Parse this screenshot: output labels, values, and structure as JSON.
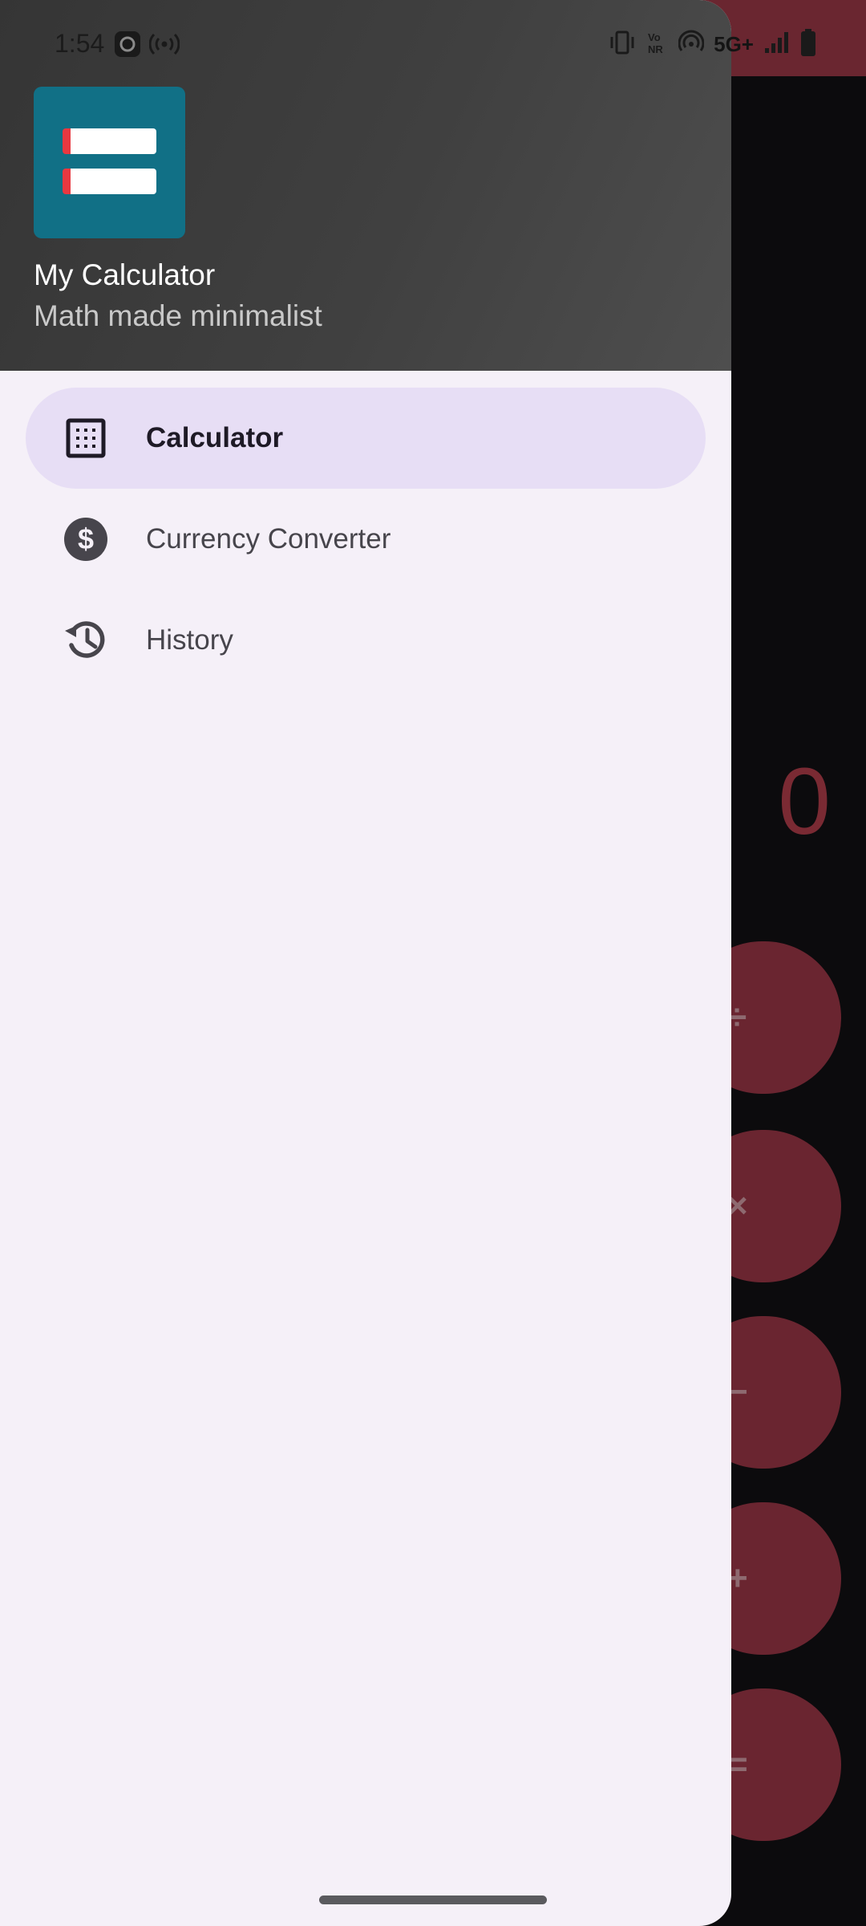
{
  "status_bar": {
    "time": "1:54",
    "network": "5G+",
    "left_icons": [
      "media-icon",
      "hotspot-icon"
    ],
    "right_icons": [
      "vibrate-icon",
      "vonr-icon",
      "wifi-calling-icon",
      "signal-icon",
      "battery-icon"
    ]
  },
  "drawer": {
    "app_name": "My Calculator",
    "tagline": "Math made minimalist",
    "items": [
      {
        "label": "Calculator",
        "icon": "calculator-icon",
        "selected": true
      },
      {
        "label": "Currency Converter",
        "icon": "dollar-icon",
        "selected": false
      },
      {
        "label": "History",
        "icon": "history-icon",
        "selected": false
      }
    ]
  },
  "background_app": {
    "display_value": "0",
    "operators": [
      "÷",
      "×",
      "−",
      "+",
      "="
    ]
  },
  "colors": {
    "drawer_bg": "#f5f0f8",
    "selected_item_bg": "#e7def5",
    "header_bg": "#3c3c3c",
    "logo_bg": "#117086",
    "accent_red": "#6a2530"
  }
}
